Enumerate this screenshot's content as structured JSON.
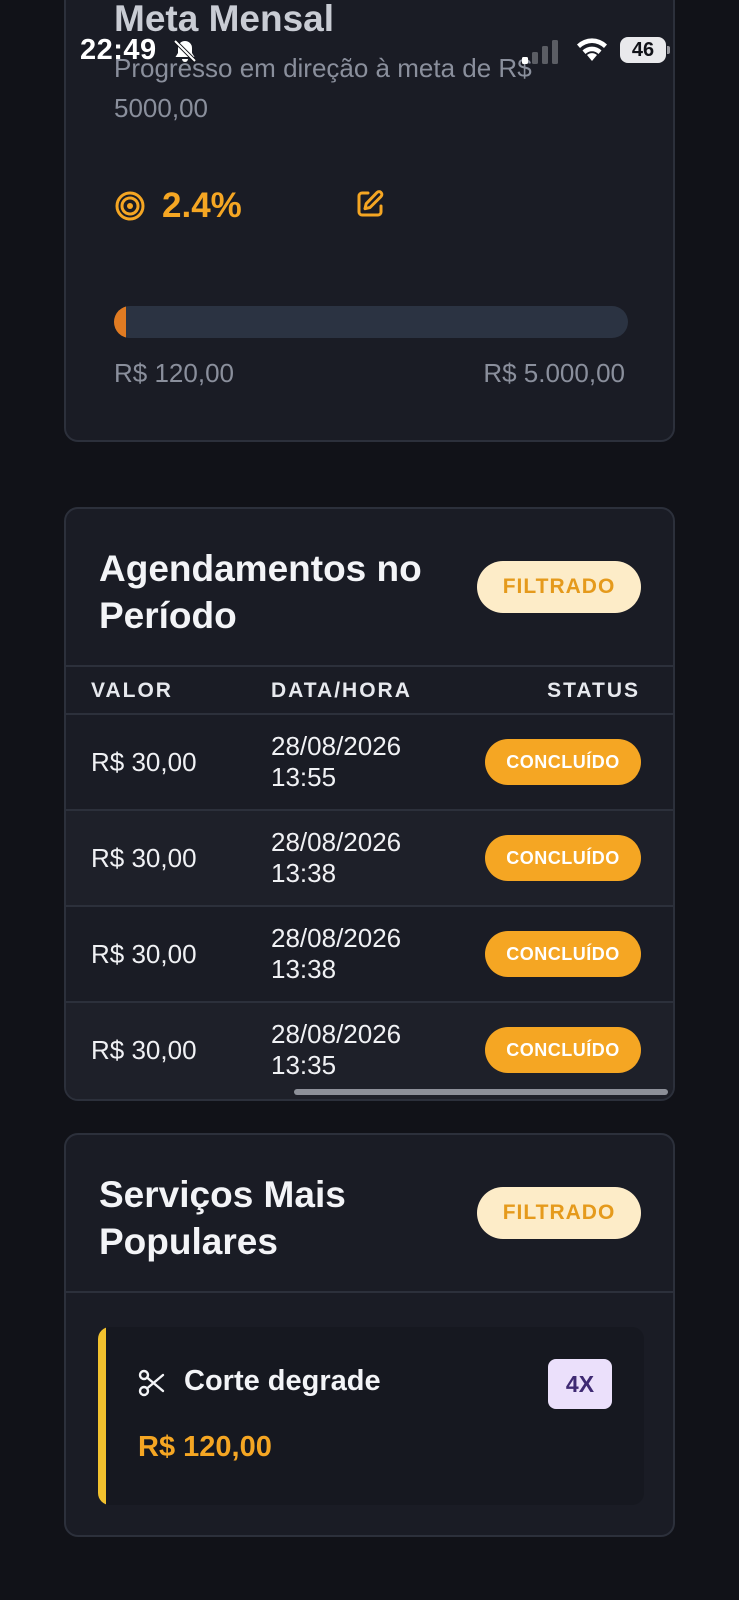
{
  "status_bar": {
    "time": "22:49",
    "battery": "46",
    "icons": [
      "bell-slash-icon",
      "signal-icon",
      "wifi-icon",
      "battery-icon"
    ]
  },
  "meta": {
    "title": "Meta Mensal",
    "subtitle": "Progresso em direção à meta de R$ 5000,00",
    "percent_label": "2.4%",
    "progress_fraction": 0.024,
    "current_label": "R$ 120,00",
    "goal_label": "R$ 5.000,00",
    "icons": [
      "target-icon",
      "edit-icon"
    ]
  },
  "agendamentos": {
    "title": "Agendamentos no Período",
    "badge": "FILTRADO",
    "columns": [
      "VALOR",
      "DATA/HORA",
      "STATUS"
    ],
    "rows": [
      {
        "valor": "R$ 30,00",
        "date": "28/08/2026",
        "time": "13:55",
        "status": "CONCLUÍDO"
      },
      {
        "valor": "R$ 30,00",
        "date": "28/08/2026",
        "time": "13:38",
        "status": "CONCLUÍDO"
      },
      {
        "valor": "R$ 30,00",
        "date": "28/08/2026",
        "time": "13:38",
        "status": "CONCLUÍDO"
      },
      {
        "valor": "R$ 30,00",
        "date": "28/08/2026",
        "time": "13:35",
        "status": "CONCLUÍDO"
      }
    ]
  },
  "servicos": {
    "title": "Serviços Mais Populares",
    "badge": "FILTRADO",
    "items": [
      {
        "name": "Corte degrade",
        "count": "4X",
        "price": "R$ 120,00",
        "icon": "scissors-icon"
      }
    ]
  },
  "colors": {
    "background": "#111218",
    "card": "#1a1c25",
    "accent_orange": "#f5a623",
    "progress_fill": "#e07b22",
    "badge_bg": "#fdecc8",
    "service_accent": "#f2c12e",
    "count_badge_bg": "#ebe0fb"
  }
}
